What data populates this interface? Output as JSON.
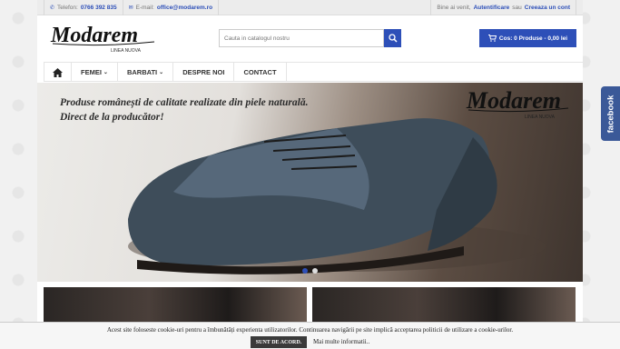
{
  "topbar": {
    "phone_label": "Telefon:",
    "phone": "0766 392 835",
    "email_label": "E-mail:",
    "email": "office@modarem.ro",
    "welcome": "Bine ai venit,",
    "login": "Autentificare",
    "or": "sau",
    "register": "Creeaza un cont"
  },
  "logo": {
    "name": "Modarem",
    "tagline": "LINEA NUOVA"
  },
  "search": {
    "placeholder": "Cauta in catalogul nostru"
  },
  "cart": {
    "label": "Cos: 0 Produse - 0,00 lei"
  },
  "nav": {
    "items": [
      {
        "label": "FEMEI"
      },
      {
        "label": "BARBATI"
      },
      {
        "label": "DESPRE NOI"
      },
      {
        "label": "CONTACT"
      }
    ]
  },
  "hero": {
    "line1": "Produse românești de calitate realizate din piele naturală.",
    "line2": "Direct de la producător!"
  },
  "cookie": {
    "message": "Acest site foloseste cookie-uri pentru a îmbunătăți experienta utilizatorilor. Continuarea navigării pe site implică acceptarea politicii de utilizare a cookie-urilor.",
    "accept": "SUNT DE ACORD.",
    "more": "Mai multe informatii.."
  },
  "facebook": {
    "label": "facebook"
  },
  "colors": {
    "accent": "#2d4fb8",
    "facebook": "#3b5998"
  },
  "icons": [
    "phone-icon",
    "mail-icon",
    "search-icon",
    "cart-icon",
    "home-icon",
    "chevron-down-icon"
  ]
}
